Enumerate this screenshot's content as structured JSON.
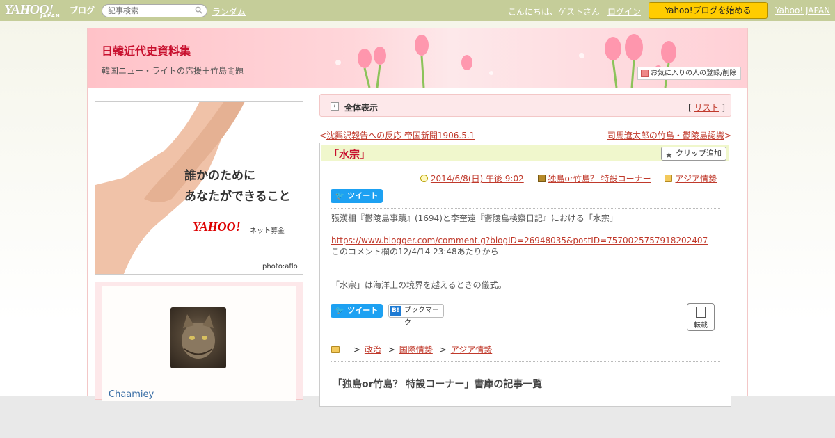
{
  "topbar": {
    "logo": "YAHOO!",
    "logo_sub": "ブログ",
    "logo_japan": "JAPAN",
    "search_placeholder": "記事検索",
    "random": "ランダム",
    "greeting": "こんにちは、ゲストさん",
    "login": "ログイン",
    "start_blog": "Yahoo!ブログを始める",
    "yahoo_japan": "Yahoo! JAPAN"
  },
  "header": {
    "title": "日韓近代史資料集",
    "description": "韓国ニュー・ライトの応援＋竹島問題",
    "favorite": "お気に入りの人の登録/削除"
  },
  "side_ad": {
    "line1": "誰かのために",
    "line2": "あなたができること",
    "brand": "YAHOO!",
    "fund": "ネット募金",
    "photo": "photo:aflo"
  },
  "profile": {
    "username": "Chaamiey"
  },
  "main": {
    "all_display": "全体表示",
    "list_open": "[",
    "list": "リスト",
    "list_close": "]",
    "prev_arrow": "<",
    "prev": "沈興沢報告への反応 帝国新聞1906.5.1",
    "next": "司馬遼太郎の竹島・鬱陵島認識",
    "next_arrow": ">"
  },
  "article": {
    "title": "「水宗」",
    "clip": "クリップ追加",
    "datetime": "2014/6/8(日) 午後 9:02",
    "book": "独島or竹島？ 特設コーナー",
    "category": "アジア情勢",
    "tweet": "ツイート",
    "bookmark": "ブックマーク",
    "bookmark_b": "B!",
    "body1": "張漢相『鬱陵島事蹟』(1694)と李奎遠『鬱陵島検察日記』における「水宗」",
    "link": "https://www.blogger.com/comment.g?blogID=26948035&postID=7570025757918202407",
    "body2": "このコメント欄の12/4/14 23:48あたりから",
    "body3": "「水宗」は海洋上の境界を越えるときの儀式。",
    "reprint": "転載",
    "crumb": [
      "政治",
      "国際情勢",
      "アジア情勢"
    ],
    "crumb_sep": ">",
    "related": "「独島or竹島？ 特設コーナー」書庫の記事一覧"
  }
}
